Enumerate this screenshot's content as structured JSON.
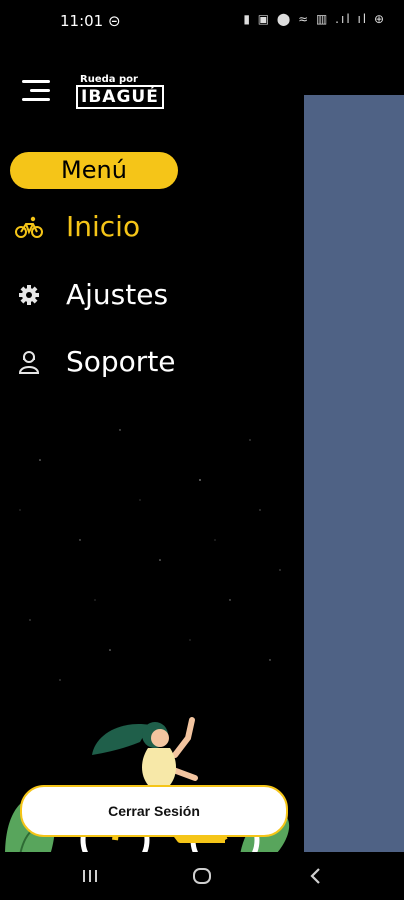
{
  "status_bar": {
    "time": "11:01 ⊝",
    "icons": "▮ ▣ ⬤ ≈ ▥ .ıl ıl ⊕"
  },
  "header": {
    "logo_small": "Rueda por",
    "logo_big": "IBAGUÉ"
  },
  "menu": {
    "title": "Menú",
    "items": [
      {
        "label": "Inicio",
        "icon": "bicycle-icon",
        "active": true
      },
      {
        "label": "Ajustes",
        "icon": "gear-icon",
        "active": false
      },
      {
        "label": "Soporte",
        "icon": "support-icon",
        "active": false
      }
    ]
  },
  "logout_label": "Cerrar Sesión",
  "colors": {
    "accent": "#f5c518",
    "background": "#000000",
    "content_panel": "#4f6285"
  }
}
